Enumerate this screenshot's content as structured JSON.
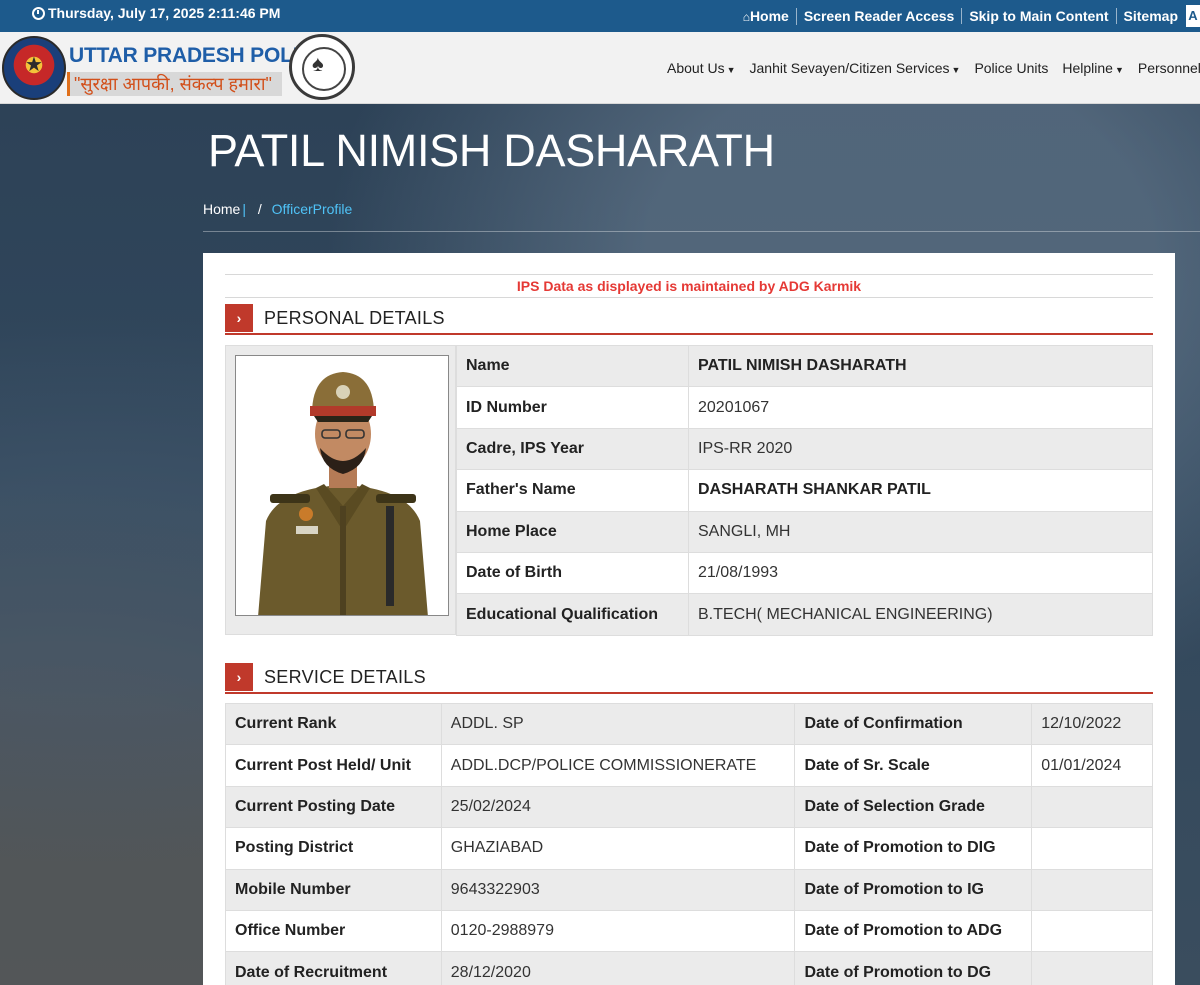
{
  "topbar": {
    "datetime": "Thursday, July 17, 2025 2:11:46 PM",
    "links": [
      "Home",
      "Screen Reader Access",
      "Skip to Main Content",
      "Sitemap"
    ],
    "font_toggle": "A"
  },
  "header": {
    "brand_title": "UTTAR PRADESH POLICE",
    "brand_tagline": "\"सुरक्षा आपकी, संकल्प हमारा\"",
    "nav": [
      "About Us",
      "Janhit Sevayen/Citizen Services",
      "Police Units",
      "Helpline",
      "Personnel"
    ]
  },
  "page": {
    "title": "PATIL NIMISH DASHARATH",
    "breadcrumb_home": "Home",
    "breadcrumb_sep": "|",
    "breadcrumb_slash": "/",
    "breadcrumb_current": "OfficerProfile"
  },
  "notice": "IPS Data as displayed is maintained by ADG Karmik",
  "personal": {
    "heading": "PERSONAL DETAILS",
    "rows": [
      {
        "label": "Name",
        "value": "PATIL NIMISH DASHARATH"
      },
      {
        "label": "ID Number",
        "value": "20201067"
      },
      {
        "label": "Cadre, IPS Year",
        "value": "IPS-RR 2020"
      },
      {
        "label": "Father's Name",
        "value": "DASHARATH SHANKAR PATIL"
      },
      {
        "label": "Home Place",
        "value": "SANGLI, MH"
      },
      {
        "label": "Date of Birth",
        "value": "21/08/1993"
      },
      {
        "label": "Educational Qualification",
        "value": "B.TECH( MECHANICAL ENGINEERING)"
      }
    ]
  },
  "service": {
    "heading": "SERVICE DETAILS",
    "rows": [
      {
        "l1": "Current Rank",
        "v1": "ADDL. SP",
        "l2": "Date of Confirmation",
        "v2": "12/10/2022"
      },
      {
        "l1": "Current Post Held/ Unit",
        "v1": "ADDL.DCP/POLICE COMMISSIONERATE",
        "l2": "Date of Sr. Scale",
        "v2": "01/01/2024"
      },
      {
        "l1": "Current Posting Date",
        "v1": "25/02/2024",
        "l2": "Date of Selection Grade",
        "v2": ""
      },
      {
        "l1": "Posting District",
        "v1": "GHAZIABAD",
        "l2": "Date of Promotion to DIG",
        "v2": ""
      },
      {
        "l1": "Mobile Number",
        "v1": "9643322903",
        "l2": "Date of Promotion to IG",
        "v2": ""
      },
      {
        "l1": "Office Number",
        "v1": "0120-2988979",
        "l2": "Date of Promotion to ADG",
        "v2": ""
      },
      {
        "l1": "Date of Recruitment",
        "v1": "28/12/2020",
        "l2": "Date of Promotion to DG",
        "v2": ""
      }
    ]
  },
  "colors": {
    "topbar": "#1d5a8c",
    "accent_red": "#c0392b",
    "notice_red": "#e53935",
    "link_blue": "#4fc3f7"
  }
}
